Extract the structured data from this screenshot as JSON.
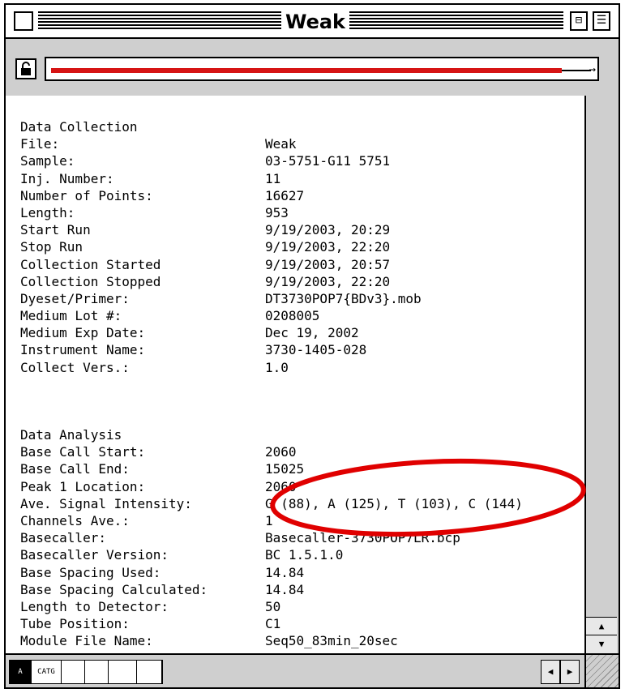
{
  "window": {
    "title": "Weak"
  },
  "icons": {
    "close": "close-box-icon",
    "zoom": "zoom-box-icon",
    "collapse": "collapse-box-icon",
    "lock": "lock-icon",
    "grow": "grow-box-icon"
  },
  "colors": {
    "progress": "#d61414",
    "annotation": "#e00000",
    "chrome": "#cfcfcf"
  },
  "data_collection": {
    "heading": "Data Collection",
    "rows": [
      {
        "label": "File:",
        "value": "Weak"
      },
      {
        "label": "Sample:",
        "value": "03-5751-G11 5751"
      },
      {
        "label": "Inj. Number:",
        "value": "11"
      },
      {
        "label": "Number of Points:",
        "value": "16627"
      },
      {
        "label": "Length:",
        "value": "953"
      },
      {
        "label": "Start Run",
        "value": "9/19/2003, 20:29"
      },
      {
        "label": "Stop Run",
        "value": "9/19/2003, 22:20"
      },
      {
        "label": "Collection Started",
        "value": "9/19/2003, 20:57"
      },
      {
        "label": "Collection Stopped",
        "value": "9/19/2003, 22:20"
      },
      {
        "label": "Dyeset/Primer:",
        "value": "DT3730POP7{BDv3}.mob"
      },
      {
        "label": "Medium Lot #:",
        "value": "0208005"
      },
      {
        "label": "Medium Exp Date:",
        "value": "Dec 19, 2002"
      },
      {
        "label": "Instrument Name:",
        "value": "3730-1405-028"
      },
      {
        "label": "Collect Vers.:",
        "value": "1.0"
      }
    ]
  },
  "data_analysis": {
    "heading": "Data Analysis",
    "rows": [
      {
        "label": "Base Call Start:",
        "value": "2060"
      },
      {
        "label": "Base Call End:",
        "value": "15025"
      },
      {
        "label": "Peak 1 Location:",
        "value": "2060"
      },
      {
        "label": "Ave. Signal Intensity:",
        "value": "G (88), A (125), T (103), C (144)"
      },
      {
        "label": "Channels Ave.:",
        "value": "1"
      },
      {
        "label": "Basecaller:",
        "value": "Basecaller-3730POP7LR.bcp"
      },
      {
        "label": "Basecaller Version:",
        "value": "BC 1.5.1.0"
      },
      {
        "label": "Base Spacing Used:",
        "value": "14.84"
      },
      {
        "label": "Base Spacing Calculated:",
        "value": "14.84"
      },
      {
        "label": "Length to Detector:",
        "value": "50"
      },
      {
        "label": "Tube Position:",
        "value": "C1"
      },
      {
        "label": "Module File Name:",
        "value": "Seq50_83min_20sec"
      }
    ]
  },
  "view_tabs": [
    {
      "label": "A",
      "icon": "annotation-view-icon"
    },
    {
      "label": "CATG",
      "icon": "sequence-view-icon"
    },
    {
      "label": "",
      "icon": "layout-view-icon"
    },
    {
      "label": "",
      "icon": "electropherogram-view-icon"
    },
    {
      "label": "",
      "icon": "raw-data-view-icon"
    },
    {
      "label": "",
      "icon": "analyzed-data-view-icon"
    }
  ],
  "scroll": {
    "up": "▲",
    "down": "▼",
    "left": "◀",
    "right": "▶"
  },
  "progress": {
    "fraction": 0.94
  }
}
